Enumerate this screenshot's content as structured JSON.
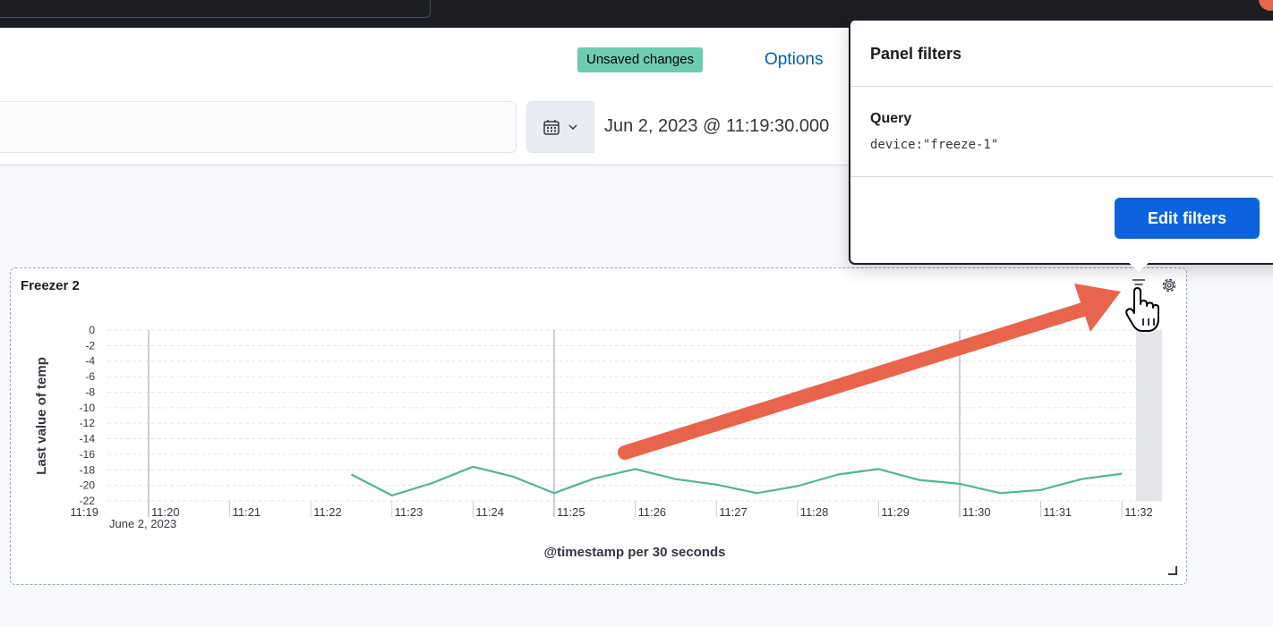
{
  "header": {
    "unsaved_badge": "Unsaved changes",
    "options_link": "Options"
  },
  "time_picker": {
    "icon": "calendar-icon",
    "start": "Jun 2, 2023 @ 11:19:30.000"
  },
  "popover": {
    "title": "Panel filters",
    "query_label": "Query",
    "query_value": "device:\"freeze-1\"",
    "edit_button": "Edit filters"
  },
  "panel": {
    "title": "Freezer 2",
    "icons": [
      "filter-icon",
      "gear-icon"
    ]
  },
  "colors": {
    "line": "#54b399",
    "accent": "#0b64dd",
    "badge": "#6dccb1",
    "arrow": "#e8644c"
  },
  "chart_data": {
    "type": "line",
    "ylabel": "Last value of temp",
    "xlabel": "@timestamp per 30 seconds",
    "x_date_label": "June 2, 2023",
    "ylim": [
      -22,
      0
    ],
    "y_ticks": [
      0,
      -2,
      -4,
      -6,
      -8,
      -10,
      -12,
      -14,
      -16,
      -18,
      -20,
      -22
    ],
    "x_ticks": [
      "11:19",
      "11:20",
      "11:21",
      "11:22",
      "11:23",
      "11:24",
      "11:25",
      "11:26",
      "11:27",
      "11:28",
      "11:29",
      "11:30",
      "11:31",
      "11:32"
    ],
    "grid": true,
    "series": [
      {
        "x": [
          "11:22:30",
          "11:23:00",
          "11:23:30",
          "11:24:00",
          "11:24:30",
          "11:25:00",
          "11:25:30",
          "11:26:00",
          "11:26:30",
          "11:27:00",
          "11:27:30",
          "11:28:00",
          "11:28:30",
          "11:29:00",
          "11:29:30",
          "11:30:00",
          "11:30:30",
          "11:31:00",
          "11:31:30",
          "11:32:00"
        ],
        "values": [
          -18.6,
          -21.3,
          -19.7,
          -17.6,
          -18.9,
          -21.0,
          -19.1,
          -17.9,
          -19.2,
          -19.9,
          -21.0,
          -20.1,
          -18.6,
          -17.9,
          -19.3,
          -19.8,
          -21.0,
          -20.6,
          -19.2,
          -18.5
        ]
      }
    ]
  }
}
